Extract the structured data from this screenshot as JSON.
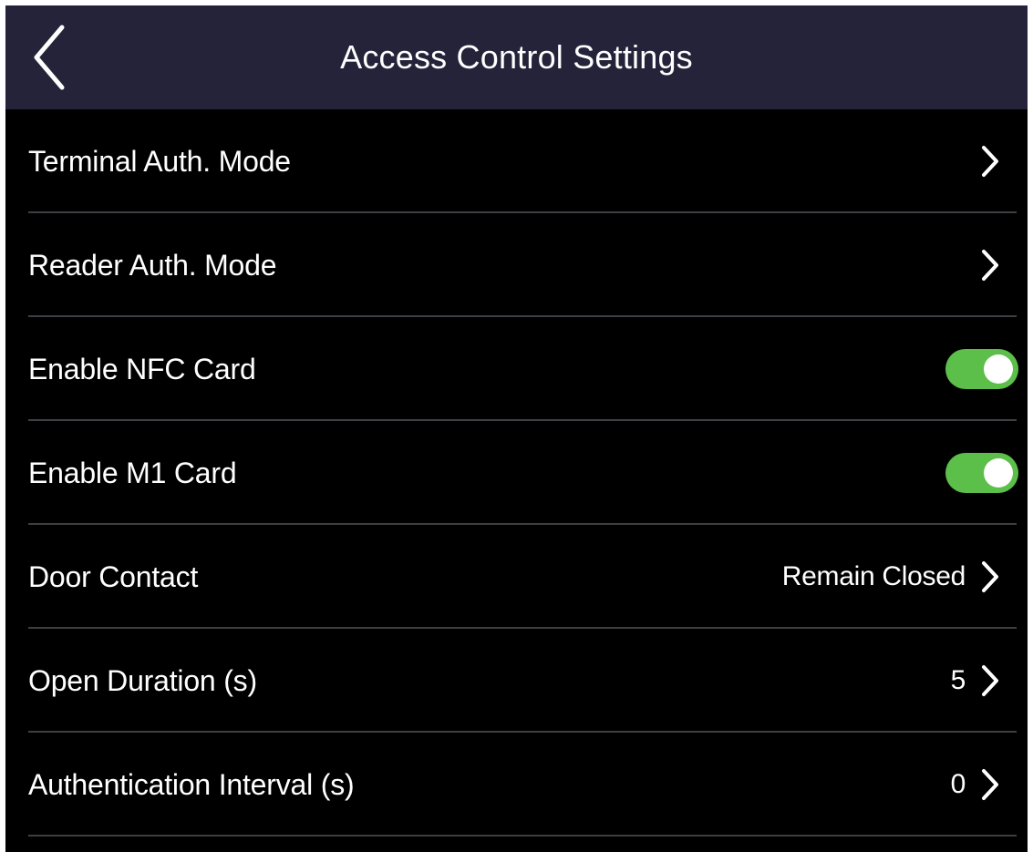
{
  "header": {
    "title": "Access Control Settings",
    "back_icon": "chevron-left-icon"
  },
  "colors": {
    "header_bg": "#24233a",
    "screen_bg": "#000000",
    "toggle_on": "#5cbf49",
    "divider": "#3e3e44"
  },
  "settings": [
    {
      "label": "Terminal Auth. Mode",
      "value": "",
      "control": "chevron"
    },
    {
      "label": "Reader Auth. Mode",
      "value": "",
      "control": "chevron"
    },
    {
      "label": "Enable NFC Card",
      "value": "",
      "control": "toggle",
      "on": true
    },
    {
      "label": "Enable M1 Card",
      "value": "",
      "control": "toggle",
      "on": true
    },
    {
      "label": "Door Contact",
      "value": "Remain Closed",
      "control": "chevron"
    },
    {
      "label": "Open Duration (s)",
      "value": "5",
      "control": "chevron"
    },
    {
      "label": "Authentication Interval (s)",
      "value": "0",
      "control": "chevron"
    }
  ]
}
